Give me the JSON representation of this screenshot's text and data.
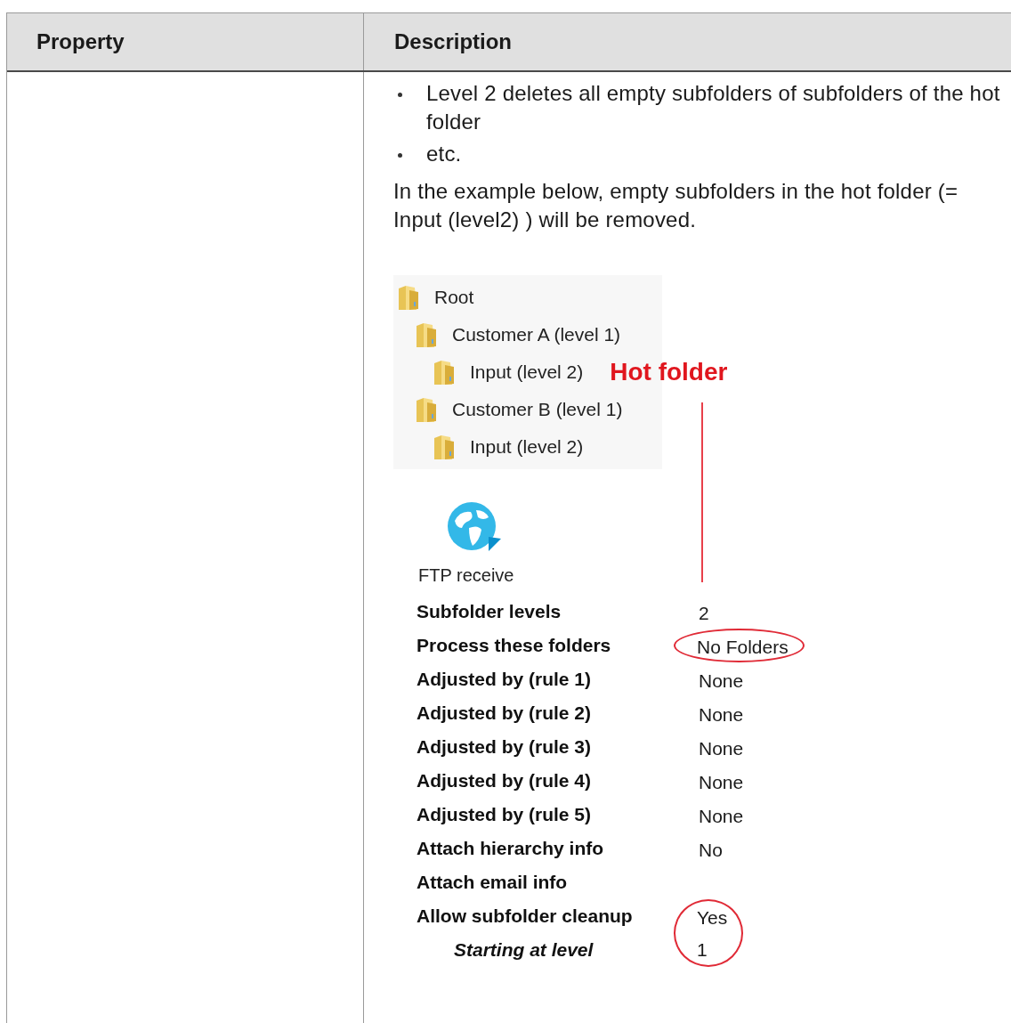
{
  "table": {
    "columns": [
      "Property",
      "Description"
    ],
    "rows": [
      {
        "description": {
          "bullets": [
            "Level 2 deletes all empty subfolders of subfolders of the hot folder",
            "etc."
          ],
          "paragraph": "In the example below, empty subfolders in the hot folder (= Input (level2) ) will be removed.",
          "figure": {
            "tree": [
              {
                "label": "Root",
                "children": [
                  {
                    "label": "Customer A (level 1)",
                    "children": [
                      {
                        "label": "Input (level 2)",
                        "annotation": "Hot folder"
                      }
                    ]
                  },
                  {
                    "label": "Customer B (level 1)",
                    "children": [
                      {
                        "label": "Input (level 2)"
                      }
                    ]
                  }
                ]
              }
            ],
            "app_icon_label": "FTP receive",
            "properties": [
              {
                "label": "Subfolder levels",
                "value": "2",
                "circled": false,
                "kind": "main"
              },
              {
                "label": "Process these folders",
                "value": "No Folders",
                "circled": true,
                "kind": "main"
              },
              {
                "label": "Adjusted by (rule 1)",
                "value": "None",
                "circled": false,
                "kind": "main"
              },
              {
                "label": "Adjusted by (rule 2)",
                "value": "None",
                "circled": false,
                "kind": "main"
              },
              {
                "label": "Adjusted by (rule 3)",
                "value": "None",
                "circled": false,
                "kind": "main"
              },
              {
                "label": "Adjusted by (rule 4)",
                "value": "None",
                "circled": false,
                "kind": "main"
              },
              {
                "label": "Adjusted by (rule 5)",
                "value": "None",
                "circled": false,
                "kind": "main"
              },
              {
                "label": "Attach hierarchy info",
                "value": "No",
                "circled": false,
                "kind": "main"
              },
              {
                "label": "Attach email info",
                "circled": false,
                "kind": "main"
              },
              {
                "label": "Allow subfolder cleanup",
                "value": "Yes",
                "circled": true,
                "kind": "main"
              },
              {
                "label": "Starting at level",
                "value": "1",
                "circled": true,
                "kind": "sub"
              }
            ]
          }
        }
      }
    ]
  }
}
